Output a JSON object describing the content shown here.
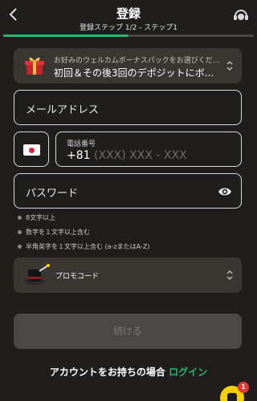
{
  "header": {
    "title": "登録",
    "subtitle": "登録ステップ 1/2 - ステップ1",
    "progress": 0.5
  },
  "bonus": {
    "line1": "お好みのウェルカムボーナスパックをお選びくだ...",
    "line2": "初回＆その後3回のデポジットにボ..."
  },
  "form": {
    "email_placeholder": "メールアドレス",
    "phone_label": "電話番号",
    "phone_code": "+81",
    "phone_mask": "(XXX) XXX - XXX",
    "password_placeholder": "パスワード"
  },
  "password_rules": [
    "8文字以上",
    "数字を１文字以上含む",
    "半角英字を１文字以上含む (a-zまたはA-Z)"
  ],
  "promo": {
    "label": "プロモコード"
  },
  "continue_label": "続ける",
  "login": {
    "prompt": "アカウントをお持ちの場合",
    "link": "ログイン"
  },
  "notification_count": "1",
  "colors": {
    "background": "#1f1e1c",
    "accent": "#2bb673",
    "panel": "#3a3733",
    "button_disabled": "#4b4945",
    "chat": "#f5d000",
    "badge": "#e53935"
  }
}
